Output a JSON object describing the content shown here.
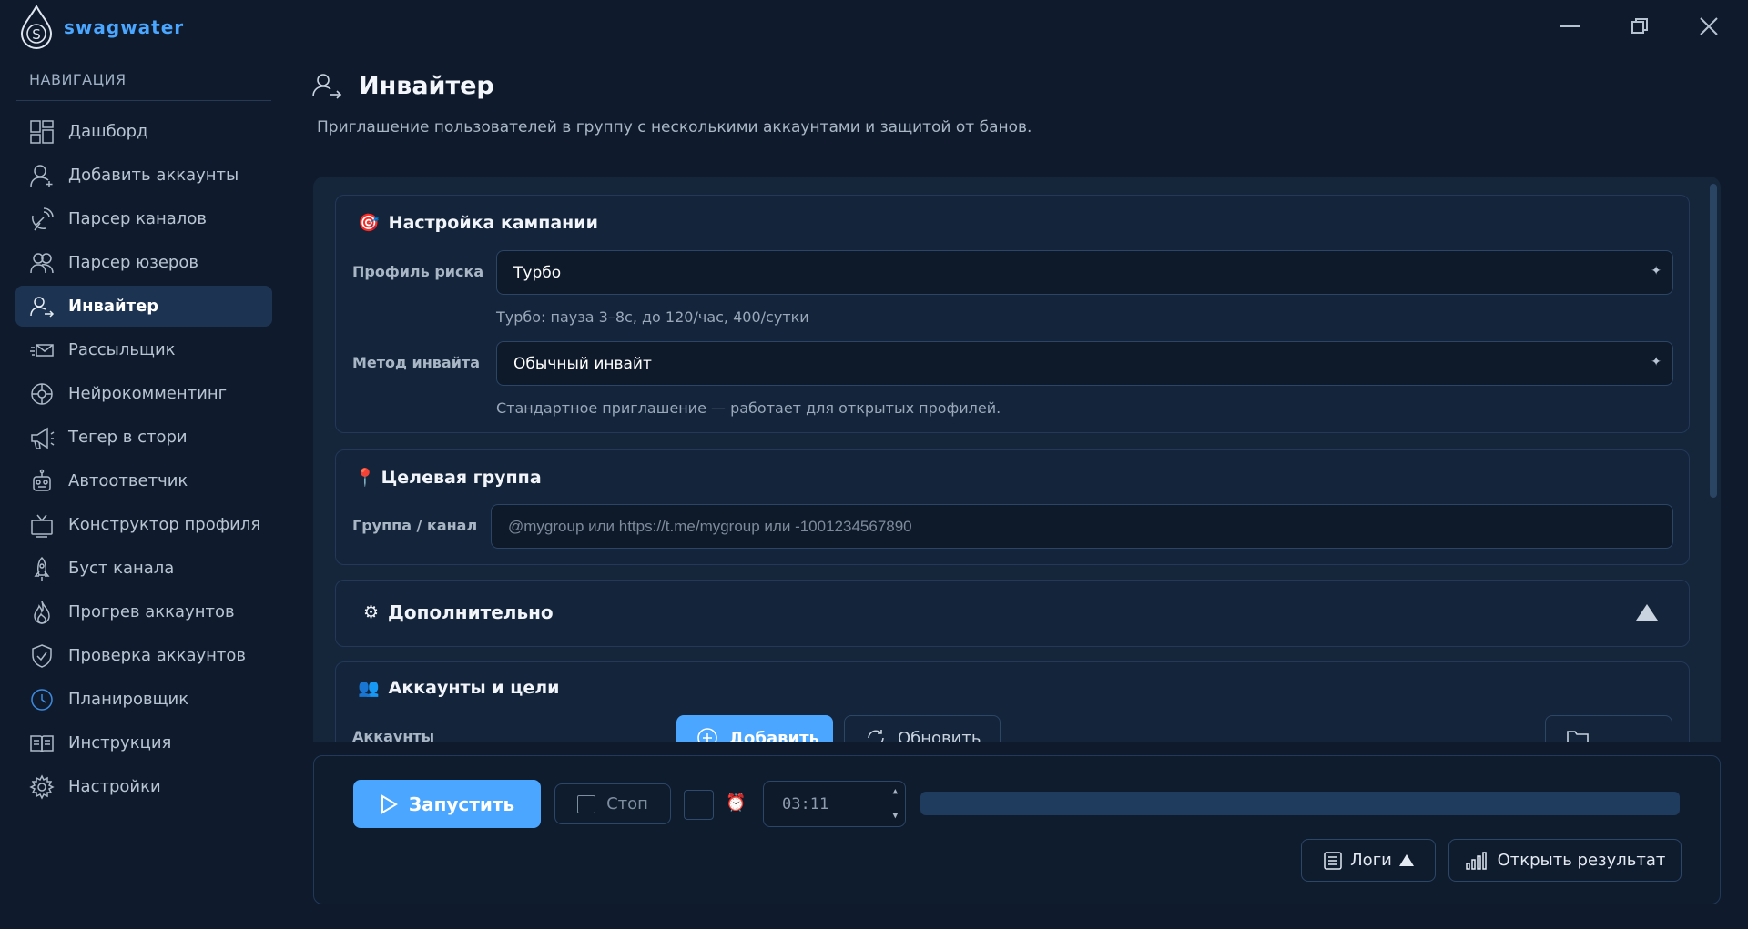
{
  "app": {
    "name": "swagwater"
  },
  "sidebar": {
    "heading": "НАВИГАЦИЯ",
    "items": [
      {
        "label": "Дашборд",
        "icon": "dashboard-icon"
      },
      {
        "label": "Добавить аккаунты",
        "icon": "add-user-icon"
      },
      {
        "label": "Парсер каналов",
        "icon": "satellite-icon"
      },
      {
        "label": "Парсер юзеров",
        "icon": "users-icon"
      },
      {
        "label": "Инвайтер",
        "icon": "invite-user-icon",
        "active": true
      },
      {
        "label": "Рассыльщик",
        "icon": "send-mail-icon"
      },
      {
        "label": "Нейрокомментинг",
        "icon": "neural-icon"
      },
      {
        "label": "Тегер в стори",
        "icon": "megaphone-icon"
      },
      {
        "label": "Автоответчик",
        "icon": "robot-icon"
      },
      {
        "label": "Конструктор профиля",
        "icon": "tv-icon"
      },
      {
        "label": "Буст канала",
        "icon": "rocket-icon"
      },
      {
        "label": "Прогрев аккаунтов",
        "icon": "flame-icon"
      },
      {
        "label": "Проверка аккаунтов",
        "icon": "shield-check-icon"
      },
      {
        "label": "Планировщик",
        "icon": "clock-icon"
      },
      {
        "label": "Инструкция",
        "icon": "book-icon"
      },
      {
        "label": "Настройки",
        "icon": "gear-icon"
      }
    ]
  },
  "page": {
    "title": "Инвайтер",
    "subtitle": "Приглашение пользователей в группу с несколькими аккаунтами и защитой от банов."
  },
  "campaign": {
    "emoji": "🎯",
    "title": "Настройка кампании",
    "risk_label": "Профиль риска",
    "risk_value": "Турбо",
    "risk_hint": "Турбо: пауза 3–8с, до 120/час, 400/сутки",
    "method_label": "Метод инвайта",
    "method_value": "Обычный инвайт",
    "method_hint": "Стандартное приглашение — работает для открытых профилей."
  },
  "target": {
    "emoji": "📍",
    "title": "Целевая группа",
    "label": "Группа / канал",
    "placeholder": "@mygroup  или  https://t.me/mygroup  или  -1001234567890"
  },
  "advanced": {
    "emoji": "⚙",
    "title": "Дополнительно"
  },
  "accounts": {
    "emoji": "👥",
    "title": "Аккаунты и цели",
    "label": "Аккаунты",
    "add_label": "Добавить",
    "refresh_label": "Обновить"
  },
  "controls": {
    "start_label": "Запустить",
    "stop_label": "Стоп",
    "alarm_emoji": "⏰",
    "time_value": "03:11",
    "progress": 0,
    "logs_label": "Логи",
    "result_label": "Открыть результат"
  },
  "colors": {
    "accent": "#4aa6ff",
    "background": "#0f1b2c",
    "card": "#14243a"
  }
}
